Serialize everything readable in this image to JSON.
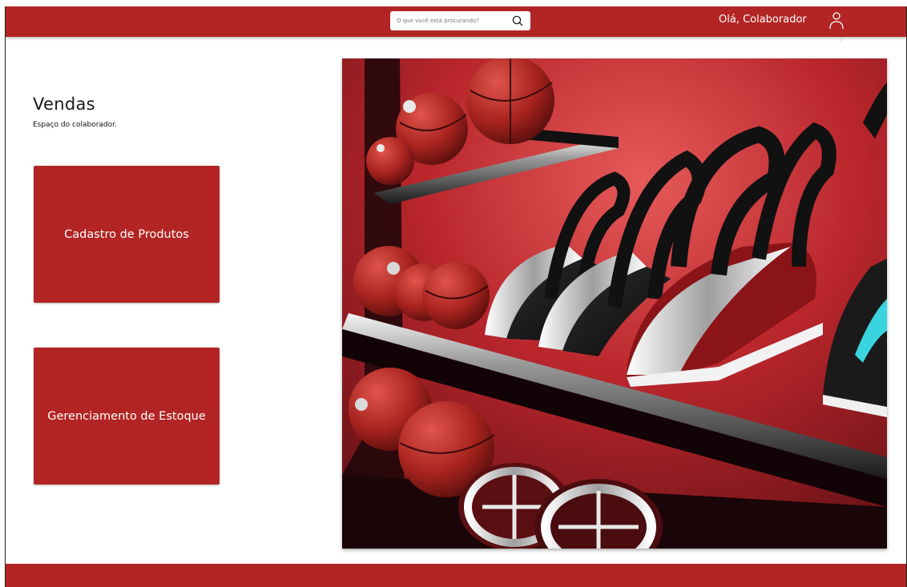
{
  "header": {
    "search": {
      "placeholder": "O que você está procurando?",
      "value": ""
    },
    "greeting": "Olá, Colaborador",
    "icons": {
      "search": "search-icon",
      "user": "user-icon"
    }
  },
  "main": {
    "title": "Vendas",
    "subtitle": "Espaço do colaborador.",
    "tiles": [
      {
        "label": "Cadastro de Produtos"
      },
      {
        "label": "Gerenciamento de Estoque"
      }
    ]
  },
  "colors": {
    "brand_red": "#b32424",
    "text_dark": "#1a1a1a",
    "background": "#ffffff"
  }
}
